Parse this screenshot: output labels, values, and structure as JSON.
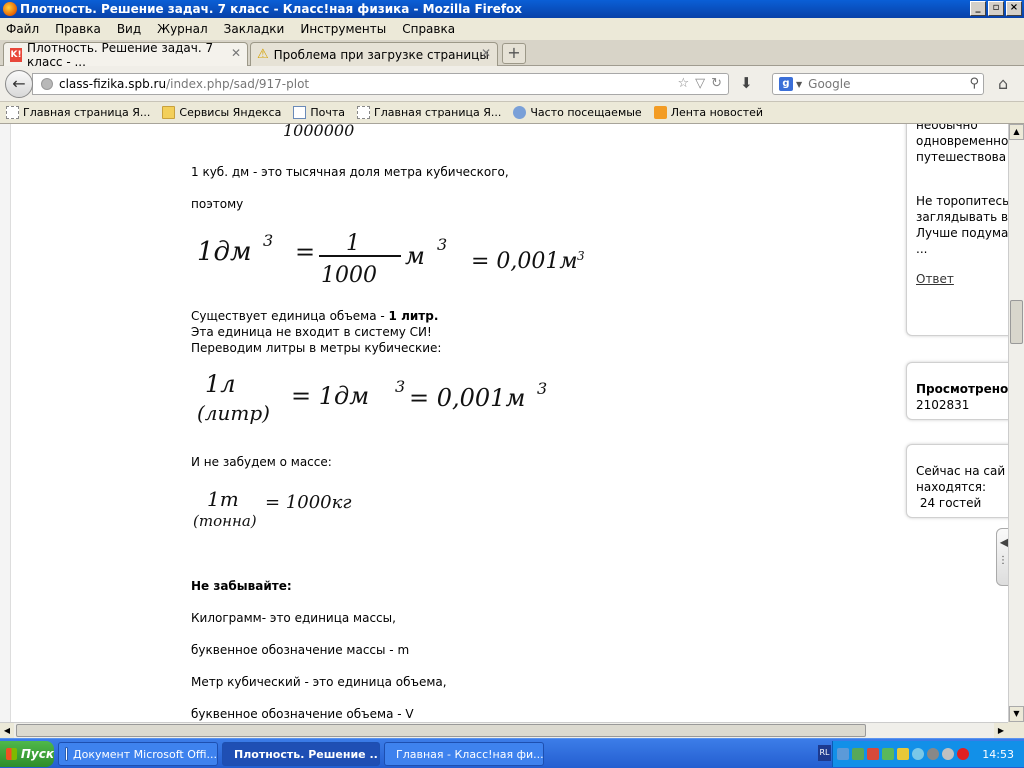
{
  "window": {
    "title": "Плотность. Решение задач. 7 класс - Класс!ная физика - Mozilla Firefox"
  },
  "menu": [
    "Файл",
    "Правка",
    "Вид",
    "Журнал",
    "Закладки",
    "Инструменты",
    "Справка"
  ],
  "tabs": [
    {
      "label": "Плотность. Решение задач. 7 класс - ...",
      "active": true
    },
    {
      "label": "Проблема при загрузке страницы",
      "active": false
    }
  ],
  "address": {
    "host": "class-fizika.spb.ru",
    "path": "/index.php/sad/917-plot"
  },
  "search": {
    "placeholder": "Google"
  },
  "bookmarks": [
    {
      "label": "Главная страница Я...",
      "icon": "page-icon"
    },
    {
      "label": "Сервисы Яндекса",
      "icon": "folder-icon"
    },
    {
      "label": "Почта",
      "icon": "mail-icon"
    },
    {
      "label": "Главная страница Я...",
      "icon": "page-icon"
    },
    {
      "label": "Часто посещаемые",
      "icon": "star-icon"
    },
    {
      "label": "Лента новостей",
      "icon": "rss-icon"
    }
  ],
  "article": {
    "p1": "1 куб. дм - это тысячная доля метра кубического,",
    "p2": "поэтому",
    "p3a": "Существует единица объема - ",
    "p3b": "1 литр.",
    "p4": "Эта единица не входит в систему СИ!",
    "p5": "Переводим литры в метры кубические:",
    "p6": "И не забудем о массе:",
    "p7": "Не забывайте:",
    "p8": "Килограмм- это единица массы,",
    "p9": "буквенное обозначение массы - m",
    "p10": "Метр кубический - это единица объема,",
    "p11": "буквенное обозначение объема - V"
  },
  "formulas": {
    "top_partial": "1000000",
    "dm": {
      "lhs": "1дм",
      "exp": "3",
      "eq": "=",
      "num": "1",
      "den": "1000",
      "unit": "м",
      "result": "= 0,001м"
    },
    "liter": {
      "lhs": "1л",
      "sub": "(литр)",
      "mid": "= 1дм",
      "rhs": "= 0,001м"
    },
    "ton": {
      "lhs": "1т",
      "sub": "(тонна)",
      "rhs": "= 1000кг"
    }
  },
  "sidebar": {
    "box1": [
      "необычно",
      "одновременно",
      "путешествова"
    ],
    "box2": [
      "Не торопитесь",
      "заглядывать в",
      "Лучше подума",
      "..."
    ],
    "answer_link": "Ответ",
    "viewed_label": "Просмотрено",
    "viewed_value": "2102831",
    "online_line1": "Сейчас на сай",
    "online_line2": "находятся:",
    "online_line3": " 24 гостей"
  },
  "taskbar": {
    "start": "Пуск",
    "tasks": [
      {
        "label": "Документ Microsoft Offi...",
        "active": false
      },
      {
        "label": "Плотность. Решение ...",
        "active": true
      },
      {
        "label": "Главная - Класс!ная фи...",
        "active": false
      }
    ],
    "lang": "RL",
    "clock": "14:53"
  }
}
